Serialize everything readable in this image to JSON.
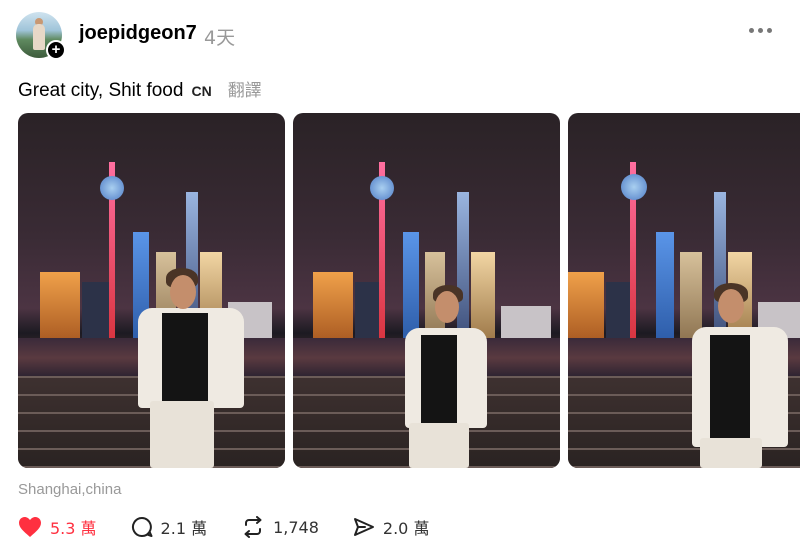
{
  "header": {
    "username": "joepidgeon7",
    "time": "4天"
  },
  "post": {
    "caption": "Great city, Shit food",
    "language_badge": "CN",
    "translate_label": "翻譯",
    "location": "Shanghai,china"
  },
  "actions": {
    "likes": "5.3 萬",
    "replies": "2.1 萬",
    "reposts": "1,748",
    "shares": "2.0 萬"
  },
  "colors": {
    "like": "#ff3040",
    "muted": "#999999"
  },
  "icons": [
    "plus-icon",
    "more-icon",
    "heart-icon",
    "comment-icon",
    "repost-icon",
    "share-icon"
  ]
}
